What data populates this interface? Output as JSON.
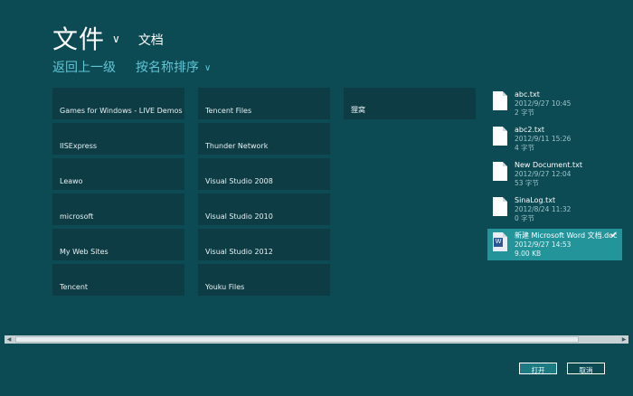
{
  "header": {
    "title": "文件",
    "location": "文档"
  },
  "subnav": {
    "go_up": "返回上一级",
    "sort": "按名称排序"
  },
  "folders": [
    "Games for Windows - LIVE Demos",
    "IISExpress",
    "Leawo",
    "microsoft",
    "My Web Sites",
    "Tencent",
    "Tencent Files",
    "Thunder Network",
    "Visual Studio 2008",
    "Visual Studio 2010",
    "Visual Studio 2012",
    "Youku Files",
    "狸窝"
  ],
  "files": [
    {
      "name": "abc.txt",
      "date": "2012/9/27 10:45",
      "size": "2 字节",
      "type": "txt",
      "selected": false
    },
    {
      "name": "abc2.txt",
      "date": "2012/9/11 15:26",
      "size": "4 字节",
      "type": "txt",
      "selected": false
    },
    {
      "name": "New Document.txt",
      "date": "2012/9/27 12:04",
      "size": "53 字节",
      "type": "txt",
      "selected": false
    },
    {
      "name": "SinaLog.txt",
      "date": "2012/8/24 11:32",
      "size": "0 字节",
      "type": "txt",
      "selected": false
    },
    {
      "name": "新建 Microsoft Word 文档.doc",
      "date": "2012/9/27 14:53",
      "size": "9.00 KB",
      "type": "doc",
      "selected": true
    }
  ],
  "buttons": {
    "open": "打开",
    "cancel": "取消"
  },
  "icons": {
    "title_chevron": "chevron-down-icon",
    "sort_chevron": "chevron-down-icon",
    "check": "check-icon",
    "scroll_left": "arrow-left-icon",
    "scroll_right": "arrow-right-icon"
  }
}
